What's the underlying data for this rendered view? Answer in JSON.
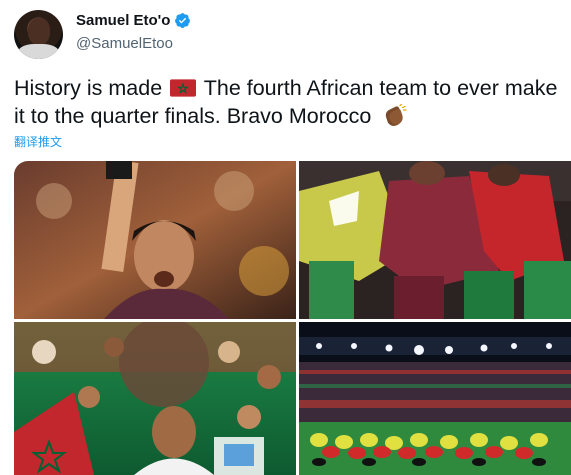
{
  "author": {
    "display_name": "Samuel Eto'o",
    "handle": "@SamuelEtoo",
    "verified": true
  },
  "tweet": {
    "text_part1": "History is made",
    "text_part2": "The fourth African team to ever make it to the quarter finals. Bravo Morocco",
    "emojis": [
      "morocco-flag",
      "clapping-hands"
    ],
    "translate_label": "翻译推文"
  },
  "media": {
    "images": [
      {
        "subject": "goalkeeper-celebrating"
      },
      {
        "subject": "players-huddle-hug"
      },
      {
        "subject": "team-collage-poster"
      },
      {
        "subject": "stadium-players-bowing"
      }
    ]
  },
  "colors": {
    "accent": "#1d9bf0",
    "text": "#0f1419",
    "secondary": "#536471",
    "morocco_red": "#c1272d",
    "morocco_green": "#006233"
  }
}
